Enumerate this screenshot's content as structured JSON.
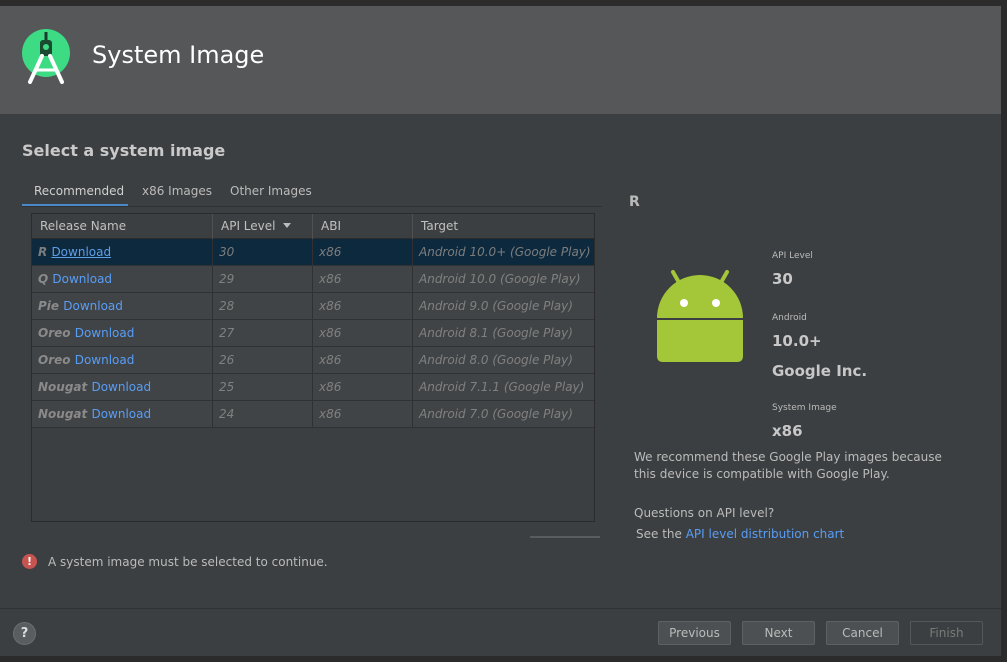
{
  "header": {
    "title": "System Image"
  },
  "section": {
    "title": "Select a system image"
  },
  "tabs": [
    {
      "label": "Recommended",
      "active": true
    },
    {
      "label": "x86 Images",
      "active": false
    },
    {
      "label": "Other Images",
      "active": false
    }
  ],
  "table": {
    "columns": [
      "Release Name",
      "API Level",
      "ABI",
      "Target"
    ],
    "rows": [
      {
        "name": "R",
        "action": "Download",
        "api": "30",
        "abi": "x86",
        "target": "Android 10.0+ (Google Play)",
        "selected": true
      },
      {
        "name": "Q",
        "action": "Download",
        "api": "29",
        "abi": "x86",
        "target": "Android 10.0 (Google Play)",
        "selected": false
      },
      {
        "name": "Pie",
        "action": "Download",
        "api": "28",
        "abi": "x86",
        "target": "Android 9.0 (Google Play)",
        "selected": false
      },
      {
        "name": "Oreo",
        "action": "Download",
        "api": "27",
        "abi": "x86",
        "target": "Android 8.1 (Google Play)",
        "selected": false
      },
      {
        "name": "Oreo",
        "action": "Download",
        "api": "26",
        "abi": "x86",
        "target": "Android 8.0 (Google Play)",
        "selected": false
      },
      {
        "name": "Nougat",
        "action": "Download",
        "api": "25",
        "abi": "x86",
        "target": "Android 7.1.1 (Google Play)",
        "selected": false
      },
      {
        "name": "Nougat",
        "action": "Download",
        "api": "24",
        "abi": "x86",
        "target": "Android 7.0 (Google Play)",
        "selected": false
      }
    ]
  },
  "error": {
    "message": "A system image must be selected to continue."
  },
  "details": {
    "title": "R",
    "api_level_label": "API Level",
    "api_level": "30",
    "android_label": "Android",
    "android_version": "10.0+",
    "vendor": "Google Inc.",
    "system_image_label": "System Image",
    "system_image": "x86",
    "recommend_text": "We recommend these Google Play images because this device is compatible with Google Play.",
    "question": "Questions on API level?",
    "see_the": "See the ",
    "chart_link": "API level distribution chart"
  },
  "footer": {
    "help": "?",
    "previous": "Previous",
    "next": "Next",
    "cancel": "Cancel",
    "finish": "Finish"
  },
  "colors": {
    "accent": "#4a88c7",
    "link": "#589df6",
    "android_green": "#a4c639",
    "error": "#c75450",
    "selection": "#0d293e"
  }
}
